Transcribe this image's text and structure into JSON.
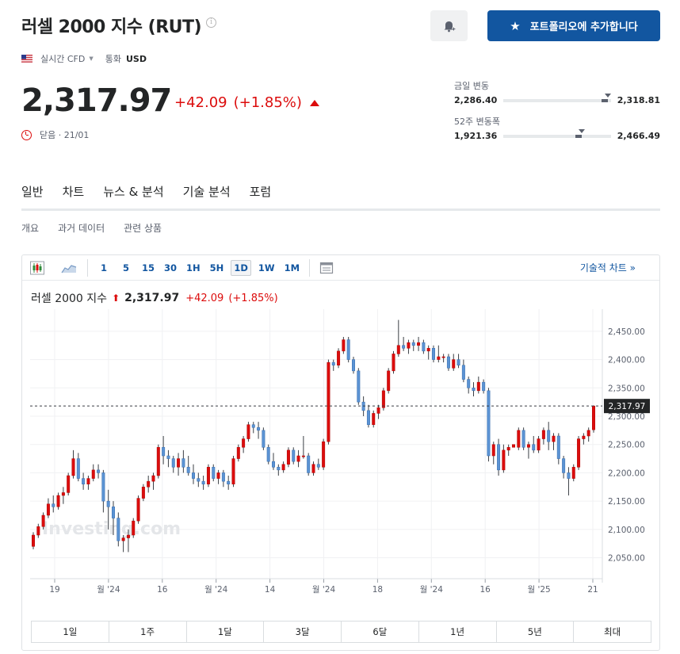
{
  "header": {
    "title": "러셀 2000 지수 (RUT)",
    "info_icon": "info-circle-icon",
    "bell_icon": "bell-plus-icon",
    "portfolio_label": "포트폴리오에 추가합니다"
  },
  "meta": {
    "feed_type": "실시간 CFD",
    "currency_label": "통화",
    "currency_value": "USD"
  },
  "quote": {
    "price": "2,317.97",
    "change": "+42.09",
    "change_pct": "(+1.85%)",
    "status": "닫음 · 21/01"
  },
  "ranges": {
    "day": {
      "label": "금일 변동",
      "low": "2,286.40",
      "high": "2,318.81",
      "low_value": 2286.4,
      "high_value": 2318.81,
      "current_value": 2317.97
    },
    "week52": {
      "label": "52주 변동폭",
      "low": "1,921.36",
      "high": "2,466.49",
      "low_value": 1921.36,
      "high_value": 2466.49,
      "current_value": 2317.97
    }
  },
  "tabs": [
    {
      "label": "일반",
      "active": true
    },
    {
      "label": "차트",
      "active": false
    },
    {
      "label": "뉴스 & 분석",
      "active": false
    },
    {
      "label": "기술 분석",
      "active": false
    },
    {
      "label": "포럼",
      "active": false
    }
  ],
  "subtabs": [
    {
      "label": "개요",
      "active": true
    },
    {
      "label": "과거 데이터",
      "active": false
    },
    {
      "label": "관련 상품",
      "active": false
    }
  ],
  "toolbar": {
    "intervals": [
      {
        "label": "1",
        "active": false
      },
      {
        "label": "5",
        "active": false
      },
      {
        "label": "15",
        "active": false
      },
      {
        "label": "30",
        "active": false
      },
      {
        "label": "1H",
        "active": false
      },
      {
        "label": "5H",
        "active": false
      },
      {
        "label": "1D",
        "active": true
      },
      {
        "label": "1W",
        "active": false
      },
      {
        "label": "1M",
        "active": false
      }
    ],
    "tech_link": "기술적 차트 »"
  },
  "chart_header": {
    "name": "러셀 2000 지수",
    "price": "2,317.97",
    "change": "+42.09",
    "change_pct": "(+1.85%)"
  },
  "periods": [
    "1일",
    "1주",
    "1달",
    "3달",
    "6달",
    "1년",
    "5년",
    "최대"
  ],
  "colors": {
    "brand_blue": "#1256a0",
    "up_red": "#dc0c0c",
    "down_blue": "#5b93d4"
  },
  "chart_data": {
    "type": "candlestick",
    "watermark": "Investing.com",
    "x_tick_labels": [
      "19",
      "월 '24",
      "16",
      "월 '24",
      "14",
      "월 '24",
      "18",
      "월 '24",
      "16",
      "월 '25",
      "21"
    ],
    "y_ticks": [
      2050,
      2100,
      2150,
      2200,
      2250,
      2300,
      2350,
      2400,
      2450
    ],
    "y_tick_labels": [
      "2,050.00",
      "2,100.00",
      "2,150.00",
      "2,200.00",
      "2,250.00",
      "2,300.00",
      "2,350.00",
      "2,400.00",
      "2,450.00"
    ],
    "ylim": [
      2020,
      2475
    ],
    "last_price": 2317.97,
    "last_price_label": "2,317.97",
    "ohlc": [
      [
        2070,
        2095,
        2065,
        2090
      ],
      [
        2090,
        2110,
        2085,
        2105
      ],
      [
        2105,
        2130,
        2100,
        2125
      ],
      [
        2125,
        2155,
        2120,
        2145
      ],
      [
        2145,
        2160,
        2130,
        2140
      ],
      [
        2140,
        2165,
        2135,
        2160
      ],
      [
        2160,
        2175,
        2145,
        2165
      ],
      [
        2165,
        2200,
        2160,
        2195
      ],
      [
        2195,
        2240,
        2190,
        2225
      ],
      [
        2225,
        2235,
        2185,
        2190
      ],
      [
        2190,
        2200,
        2170,
        2180
      ],
      [
        2180,
        2195,
        2170,
        2190
      ],
      [
        2190,
        2215,
        2185,
        2205
      ],
      [
        2205,
        2215,
        2190,
        2200
      ],
      [
        2200,
        2205,
        2130,
        2150
      ],
      [
        2150,
        2170,
        2100,
        2140
      ],
      [
        2140,
        2150,
        2090,
        2120
      ],
      [
        2120,
        2130,
        2070,
        2080
      ],
      [
        2080,
        2090,
        2060,
        2085
      ],
      [
        2085,
        2100,
        2060,
        2090
      ],
      [
        2090,
        2120,
        2085,
        2115
      ],
      [
        2115,
        2160,
        2110,
        2155
      ],
      [
        2155,
        2180,
        2150,
        2175
      ],
      [
        2175,
        2195,
        2165,
        2185
      ],
      [
        2185,
        2200,
        2170,
        2195
      ],
      [
        2195,
        2250,
        2190,
        2245
      ],
      [
        2245,
        2265,
        2215,
        2230
      ],
      [
        2230,
        2240,
        2210,
        2225
      ],
      [
        2225,
        2230,
        2200,
        2210
      ],
      [
        2210,
        2235,
        2195,
        2225
      ],
      [
        2225,
        2240,
        2200,
        2210
      ],
      [
        2210,
        2230,
        2195,
        2200
      ],
      [
        2200,
        2215,
        2180,
        2190
      ],
      [
        2190,
        2200,
        2175,
        2185
      ],
      [
        2185,
        2195,
        2170,
        2180
      ],
      [
        2180,
        2215,
        2175,
        2210
      ],
      [
        2210,
        2215,
        2185,
        2190
      ],
      [
        2190,
        2205,
        2180,
        2200
      ],
      [
        2200,
        2205,
        2175,
        2185
      ],
      [
        2185,
        2195,
        2170,
        2180
      ],
      [
        2180,
        2230,
        2175,
        2225
      ],
      [
        2225,
        2250,
        2220,
        2245
      ],
      [
        2245,
        2265,
        2235,
        2260
      ],
      [
        2260,
        2290,
        2255,
        2285
      ],
      [
        2285,
        2290,
        2270,
        2280
      ],
      [
        2280,
        2290,
        2260,
        2275
      ],
      [
        2275,
        2280,
        2240,
        2245
      ],
      [
        2245,
        2250,
        2215,
        2220
      ],
      [
        2220,
        2235,
        2205,
        2210
      ],
      [
        2210,
        2215,
        2195,
        2205
      ],
      [
        2205,
        2220,
        2200,
        2215
      ],
      [
        2215,
        2245,
        2210,
        2240
      ],
      [
        2240,
        2245,
        2215,
        2220
      ],
      [
        2220,
        2240,
        2210,
        2230
      ],
      [
        2230,
        2265,
        2225,
        2230
      ],
      [
        2230,
        2235,
        2195,
        2200
      ],
      [
        2200,
        2220,
        2195,
        2215
      ],
      [
        2215,
        2225,
        2205,
        2210
      ],
      [
        2210,
        2260,
        2205,
        2255
      ],
      [
        2255,
        2400,
        2250,
        2395
      ],
      [
        2395,
        2400,
        2380,
        2390
      ],
      [
        2390,
        2420,
        2385,
        2415
      ],
      [
        2415,
        2440,
        2410,
        2435
      ],
      [
        2435,
        2440,
        2395,
        2400
      ],
      [
        2400,
        2405,
        2375,
        2380
      ],
      [
        2380,
        2385,
        2320,
        2325
      ],
      [
        2325,
        2335,
        2300,
        2310
      ],
      [
        2310,
        2320,
        2280,
        2285
      ],
      [
        2285,
        2310,
        2280,
        2305
      ],
      [
        2305,
        2320,
        2295,
        2315
      ],
      [
        2315,
        2350,
        2310,
        2345
      ],
      [
        2345,
        2385,
        2340,
        2380
      ],
      [
        2380,
        2415,
        2375,
        2410
      ],
      [
        2410,
        2470,
        2405,
        2425
      ],
      [
        2425,
        2440,
        2415,
        2420
      ],
      [
        2420,
        2435,
        2410,
        2430
      ],
      [
        2430,
        2435,
        2415,
        2425
      ],
      [
        2425,
        2440,
        2415,
        2430
      ],
      [
        2430,
        2435,
        2410,
        2415
      ],
      [
        2415,
        2425,
        2400,
        2420
      ],
      [
        2420,
        2425,
        2395,
        2400
      ],
      [
        2400,
        2425,
        2395,
        2405
      ],
      [
        2405,
        2410,
        2395,
        2405
      ],
      [
        2405,
        2410,
        2380,
        2385
      ],
      [
        2385,
        2410,
        2380,
        2400
      ],
      [
        2400,
        2410,
        2385,
        2390
      ],
      [
        2390,
        2400,
        2360,
        2365
      ],
      [
        2365,
        2370,
        2340,
        2350
      ],
      [
        2350,
        2360,
        2335,
        2345
      ],
      [
        2345,
        2370,
        2340,
        2360
      ],
      [
        2360,
        2365,
        2340,
        2345
      ],
      [
        2345,
        2350,
        2220,
        2230
      ],
      [
        2230,
        2255,
        2215,
        2250
      ],
      [
        2250,
        2260,
        2195,
        2205
      ],
      [
        2205,
        2250,
        2200,
        2240
      ],
      [
        2240,
        2250,
        2230,
        2245
      ],
      [
        2245,
        2250,
        2245,
        2250
      ],
      [
        2245,
        2280,
        2240,
        2275
      ],
      [
        2275,
        2280,
        2240,
        2245
      ],
      [
        2245,
        2255,
        2225,
        2250
      ],
      [
        2250,
        2265,
        2235,
        2240
      ],
      [
        2240,
        2265,
        2235,
        2260
      ],
      [
        2260,
        2280,
        2250,
        2275
      ],
      [
        2275,
        2290,
        2240,
        2255
      ],
      [
        2255,
        2270,
        2240,
        2265
      ],
      [
        2265,
        2270,
        2215,
        2225
      ],
      [
        2225,
        2230,
        2190,
        2200
      ],
      [
        2200,
        2210,
        2160,
        2190
      ],
      [
        2190,
        2215,
        2185,
        2210
      ],
      [
        2210,
        2265,
        2205,
        2260
      ],
      [
        2260,
        2270,
        2250,
        2265
      ],
      [
        2265,
        2280,
        2255,
        2275
      ],
      [
        2276,
        2319,
        2271,
        2318
      ]
    ]
  }
}
